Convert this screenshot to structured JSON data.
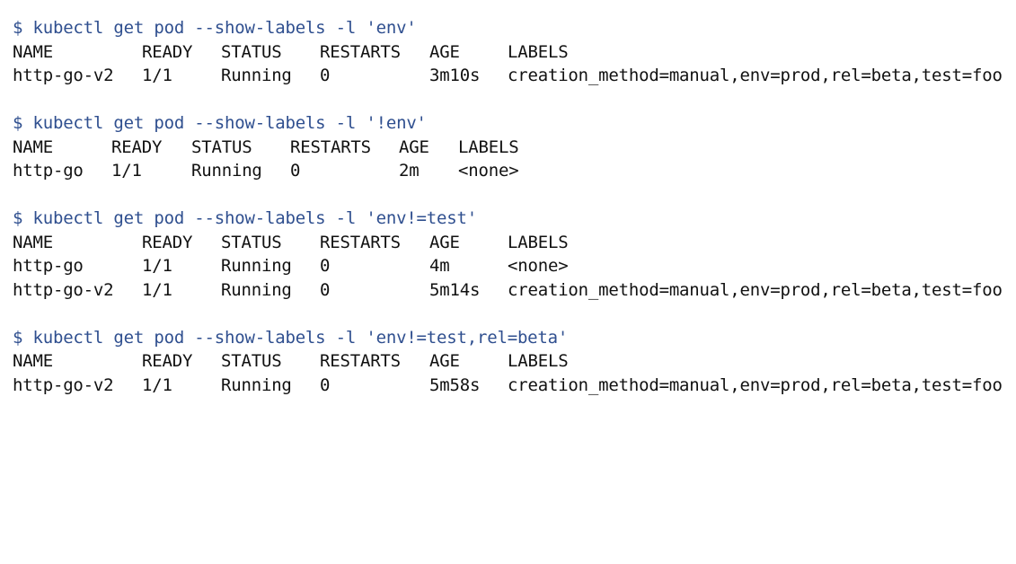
{
  "blocks": [
    {
      "command": "$ kubectl get pod --show-labels -l 'env'",
      "columns": [
        "NAME",
        "READY",
        "STATUS",
        "RESTARTS",
        "AGE",
        "LABELS"
      ],
      "rows": [
        [
          "http-go-v2",
          "1/1",
          "Running",
          "0",
          "3m10s",
          "creation_method=manual,env=prod,rel=beta,test=foo"
        ]
      ]
    },
    {
      "command": "$ kubectl get pod --show-labels -l '!env'",
      "columns": [
        "NAME",
        "READY",
        "STATUS",
        "RESTARTS",
        "AGE",
        "LABELS"
      ],
      "rows": [
        [
          "http-go",
          "1/1",
          "Running",
          "0",
          "2m",
          "<none>"
        ]
      ]
    },
    {
      "command": "$ kubectl get pod --show-labels -l 'env!=test'",
      "columns": [
        "NAME",
        "READY",
        "STATUS",
        "RESTARTS",
        "AGE",
        "LABELS"
      ],
      "rows": [
        [
          "http-go",
          "1/1",
          "Running",
          "0",
          "4m",
          "<none>"
        ],
        [
          "http-go-v2",
          "1/1",
          "Running",
          "0",
          "5m14s",
          "creation_method=manual,env=prod,rel=beta,test=foo"
        ]
      ]
    },
    {
      "command": "$ kubectl get pod --show-labels -l 'env!=test,rel=beta'",
      "columns": [
        "NAME",
        "READY",
        "STATUS",
        "RESTARTS",
        "AGE",
        "LABELS"
      ],
      "rows": [
        [
          "http-go-v2",
          "1/1",
          "Running",
          "0",
          "5m58s",
          "creation_method=manual,env=prod,rel=beta,test=foo"
        ]
      ]
    }
  ],
  "colors": {
    "command": "#2f4f8f",
    "output": "#111111",
    "background": "#ffffff"
  }
}
